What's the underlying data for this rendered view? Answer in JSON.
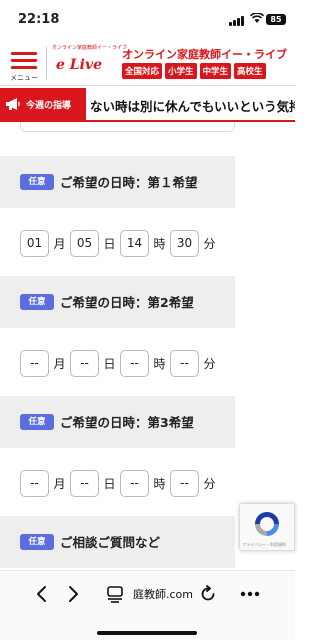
{
  "status": {
    "time": "22:18",
    "battery": "85"
  },
  "header": {
    "menu_label": "メニュー",
    "logo_small": "オンライン家庭教師イー・ライブ",
    "logo_text": "e Live",
    "brand": "オンライン家庭教師イー・ライブ",
    "tags": [
      "全国対応",
      "小学生",
      "中学生",
      "高校生"
    ]
  },
  "banner": {
    "tag": "今週の指導",
    "message": "ない時は別に休んでもいいという気持ち"
  },
  "sections": [
    {
      "badge": "任意",
      "title": "ご希望の日時：第１希望",
      "month": "01",
      "day": "05",
      "hour": "14",
      "minute": "30"
    },
    {
      "badge": "任意",
      "title": "ご希望の日時：第2希望",
      "month": "--",
      "day": "--",
      "hour": "--",
      "minute": "--"
    },
    {
      "badge": "任意",
      "title": "ご希望の日時：第3希望",
      "month": "--",
      "day": "--",
      "hour": "--",
      "minute": "--"
    },
    {
      "badge": "任意",
      "title": "ご相談ご質問など"
    }
  ],
  "units": {
    "month": "月",
    "day": "日",
    "hour": "時",
    "minute": "分"
  },
  "recaptcha": {
    "text": "プライバシー・利用規約"
  },
  "toolbar": {
    "url": "庭教師.com"
  },
  "colors": {
    "brand_red": "#d8161b",
    "badge_blue": "#5a6ee0",
    "section_bg": "#eeeeee"
  }
}
